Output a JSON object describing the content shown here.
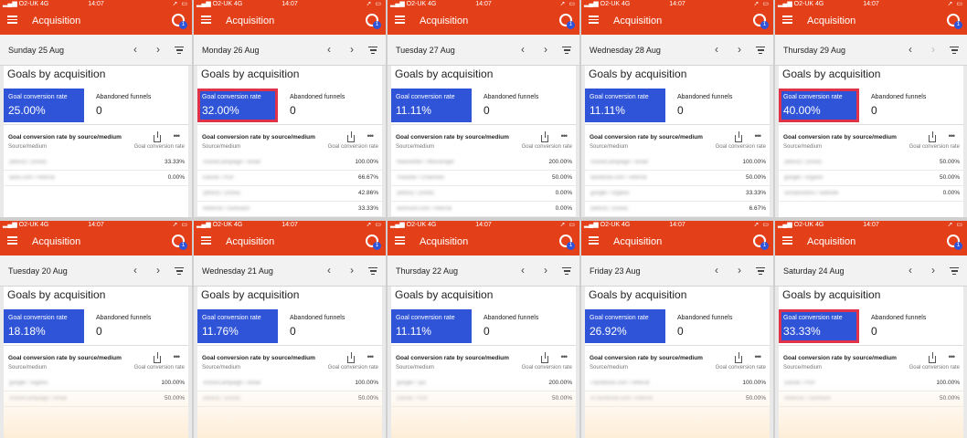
{
  "status": {
    "carrier": "O2-UK",
    "network": "4G",
    "time": "14:07"
  },
  "app": {
    "title": "Acquisition",
    "account_badge": "1"
  },
  "card": {
    "title": "Goals by acquisition",
    "gcr_label": "Goal conversion rate",
    "abandoned_label": "Abandoned funnels",
    "table_title": "Goal conversion rate by source/medium",
    "col_source": "Source/medium",
    "col_rate": "Goal conversion rate"
  },
  "colors": {
    "appbar": "#e3401a",
    "metric": "#2f54d8",
    "highlight": "#e0334a"
  },
  "panels": [
    {
      "date": "Sunday 25 Aug",
      "gcr": "25.00%",
      "abandoned": "0",
      "highlight": false,
      "next_disabled": false,
      "rows": [
        {
          "source": "(direct) / (none)",
          "value": "33.33%"
        },
        {
          "source": "lastu.com / referral",
          "value": "0.00%"
        }
      ]
    },
    {
      "date": "Monday 26 Aug",
      "gcr": "32.00%",
      "abandoned": "0",
      "highlight": true,
      "next_disabled": false,
      "rows": [
        {
          "source": "ActiveCampaign / email",
          "value": "100.00%"
        },
        {
          "source": "EBook / PDF",
          "value": "66.67%"
        },
        {
          "source": "(direct) / (none)",
          "value": "42.86%"
        },
        {
          "source": "Referral / Outreach",
          "value": "33.33%"
        },
        {
          "source": "Facebook / Ad",
          "value": "0.00%"
        }
      ]
    },
    {
      "date": "Tuesday 27 Aug",
      "gcr": "11.11%",
      "abandoned": "0",
      "highlight": false,
      "next_disabled": false,
      "rows": [
        {
          "source": "Newsletter / Messenger",
          "value": "200.00%"
        },
        {
          "source": "Youtube / Channels",
          "value": "50.00%"
        },
        {
          "source": "(direct) / (none)",
          "value": "0.00%"
        },
        {
          "source": "semrush.com / referral",
          "value": "0.00%"
        },
        {
          "source": "EBook / PDF",
          "value": "0.00%"
        }
      ]
    },
    {
      "date": "Wednesday 28 Aug",
      "gcr": "11.11%",
      "abandoned": "0",
      "highlight": false,
      "next_disabled": false,
      "rows": [
        {
          "source": "ActiveCampaign / email",
          "value": "100.00%"
        },
        {
          "source": "facebook.com / referral",
          "value": "50.00%"
        },
        {
          "source": "google / organic",
          "value": "33.33%"
        },
        {
          "source": "(direct) / (none)",
          "value": "6.67%"
        },
        {
          "source": "dashboard.hermhum.co.uk",
          "value": "0.00%"
        }
      ]
    },
    {
      "date": "Thursday 29 Aug",
      "gcr": "40.00%",
      "abandoned": "0",
      "highlight": true,
      "next_disabled": true,
      "rows": [
        {
          "source": "(direct) / (none)",
          "value": "50.00%"
        },
        {
          "source": "google / organic",
          "value": "50.00%"
        },
        {
          "source": "socialvisitors / website",
          "value": "0.00%"
        }
      ]
    },
    {
      "date": "Tuesday 20 Aug",
      "gcr": "18.18%",
      "abandoned": "0",
      "highlight": false,
      "next_disabled": false,
      "rows": [
        {
          "source": "google / organic",
          "value": "100.00%"
        },
        {
          "source": "ActiveCampaign / email",
          "value": "50.00%"
        }
      ]
    },
    {
      "date": "Wednesday 21 Aug",
      "gcr": "11.76%",
      "abandoned": "0",
      "highlight": false,
      "next_disabled": false,
      "rows": [
        {
          "source": "ActiveCampaign / email",
          "value": "100.00%"
        },
        {
          "source": "(direct) / (none)",
          "value": "50.00%"
        }
      ]
    },
    {
      "date": "Thursday 22 Aug",
      "gcr": "11.11%",
      "abandoned": "0",
      "highlight": false,
      "next_disabled": false,
      "rows": [
        {
          "source": "google / cpc",
          "value": "200.00%"
        },
        {
          "source": "EBook / PDF",
          "value": "50.00%"
        }
      ]
    },
    {
      "date": "Friday 23 Aug",
      "gcr": "26.92%",
      "abandoned": "0",
      "highlight": false,
      "next_disabled": false,
      "rows": [
        {
          "source": "l.facebook.com / referral",
          "value": "100.00%"
        },
        {
          "source": "m.facebook.com / referral",
          "value": "50.00%"
        }
      ]
    },
    {
      "date": "Saturday 24 Aug",
      "gcr": "33.33%",
      "abandoned": "0",
      "highlight": true,
      "next_disabled": false,
      "rows": [
        {
          "source": "EBook / PDF",
          "value": "100.00%"
        },
        {
          "source": "Referral / Outreach",
          "value": "50.00%"
        }
      ]
    }
  ]
}
